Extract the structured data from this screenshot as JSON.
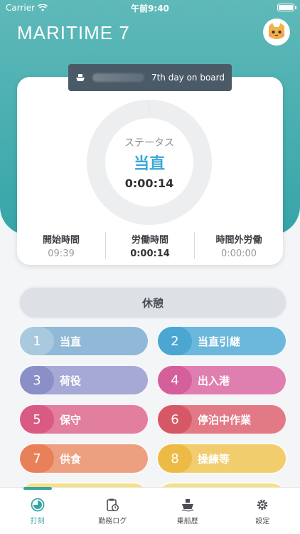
{
  "status_bar": {
    "carrier": "Carrier",
    "time": "午前9:40"
  },
  "app_title": "MARITIME 7",
  "board": {
    "days_on_board": "7th day on board"
  },
  "status_ring": {
    "label": "ステータス",
    "status": "当直",
    "elapsed": "0:00:14"
  },
  "stats": [
    {
      "label": "開始時間",
      "value": "09:39"
    },
    {
      "label": "労働時間",
      "value": "0:00:14"
    },
    {
      "label": "時間外労働",
      "value": "0:00:00"
    }
  ],
  "rest_label": "休憩",
  "duties": [
    {
      "num": "1",
      "label": "当直",
      "color": "#8fb9d6",
      "num_color": "#a9c9de"
    },
    {
      "num": "2",
      "label": "当直引継",
      "color": "#6cb8dc",
      "num_color": "#4ba6d2"
    },
    {
      "num": "3",
      "label": "荷役",
      "color": "#a6a9d6",
      "num_color": "#8b8fc8"
    },
    {
      "num": "4",
      "label": "出入港",
      "color": "#df7fb0",
      "num_color": "#d45f9b"
    },
    {
      "num": "5",
      "label": "保守",
      "color": "#e27e9e",
      "num_color": "#d95a83"
    },
    {
      "num": "6",
      "label": "停泊中作業",
      "color": "#e27a86",
      "num_color": "#d65866"
    },
    {
      "num": "7",
      "label": "供食",
      "color": "#eda080",
      "num_color": "#e8805a"
    },
    {
      "num": "8",
      "label": "操練等",
      "color": "#f1cd6e",
      "num_color": "#ecbb45"
    }
  ],
  "tabs": [
    {
      "label": "打刻",
      "icon": "clock-icon",
      "active": true
    },
    {
      "label": "勤務ログ",
      "icon": "clipboard-clock-icon",
      "active": false
    },
    {
      "label": "乗船歴",
      "icon": "ship-icon",
      "active": false
    },
    {
      "label": "設定",
      "icon": "gear-icon",
      "active": false
    }
  ],
  "colors": {
    "accent": "#36a5a8",
    "status_blue": "#3aa8d8"
  }
}
